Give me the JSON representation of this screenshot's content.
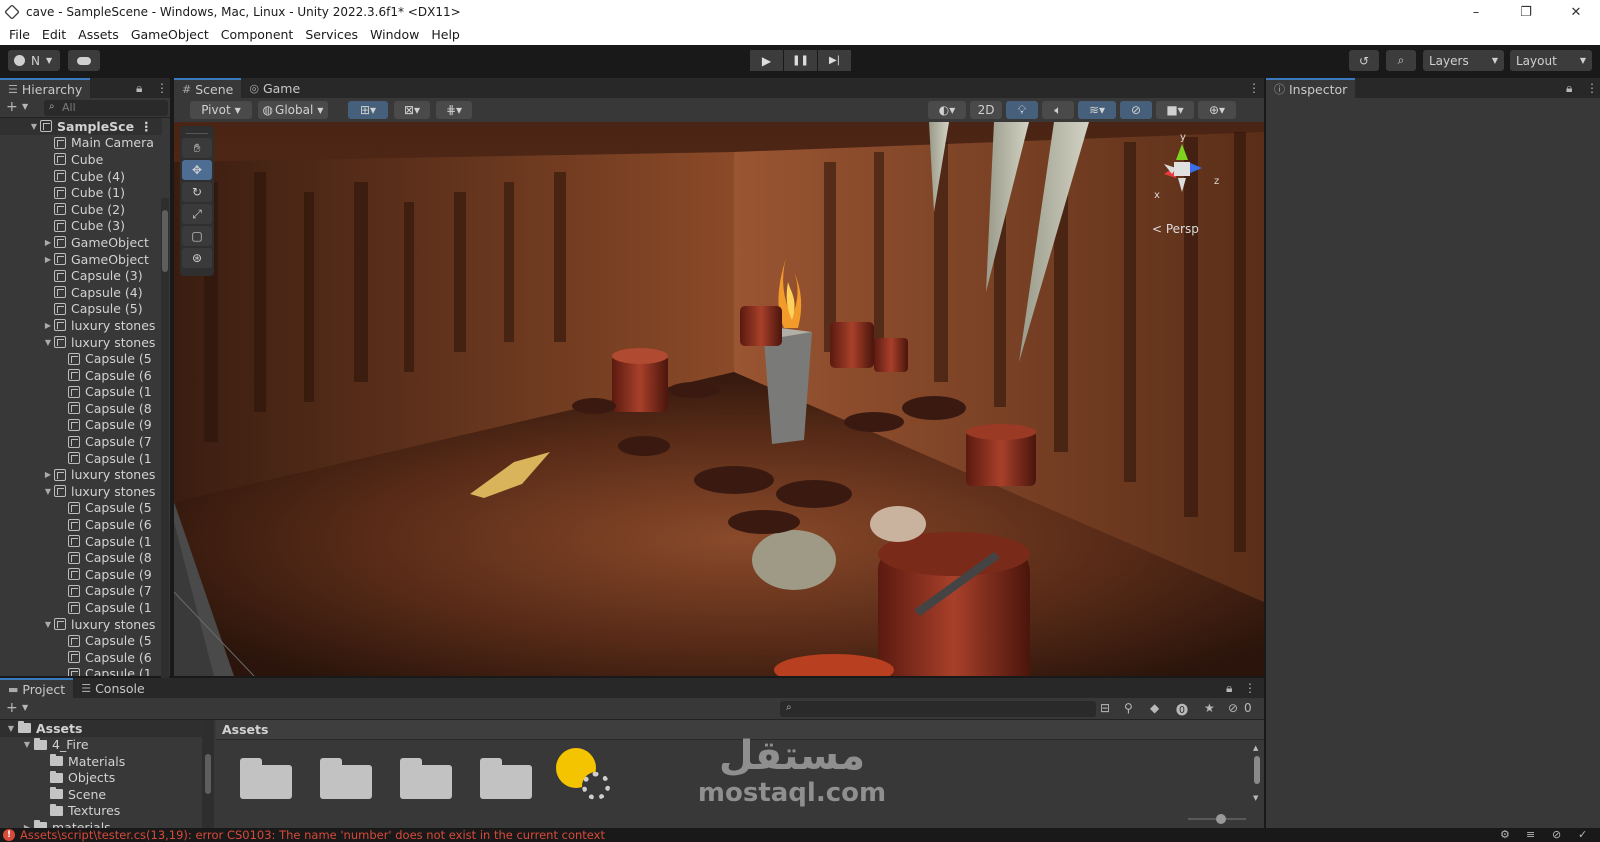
{
  "window": {
    "title": "cave - SampleScene - Windows, Mac, Linux - Unity 2022.3.6f1* <DX11>",
    "controls": [
      "–",
      "❐",
      "✕"
    ]
  },
  "menu": [
    "File",
    "Edit",
    "Assets",
    "GameObject",
    "Component",
    "Services",
    "Window",
    "Help"
  ],
  "toolbar": {
    "account_label": "N",
    "layers_label": "Layers",
    "layout_label": "Layout"
  },
  "hierarchy": {
    "tab_label": "Hierarchy",
    "search_placeholder": "All",
    "items": [
      {
        "label": "SampleSce",
        "depth": 0,
        "arrow": "▼",
        "root": true
      },
      {
        "label": "Main Camera",
        "depth": 1,
        "arrow": ""
      },
      {
        "label": "Cube",
        "depth": 1,
        "arrow": ""
      },
      {
        "label": "Cube (4)",
        "depth": 1,
        "arrow": ""
      },
      {
        "label": "Cube (1)",
        "depth": 1,
        "arrow": ""
      },
      {
        "label": "Cube (2)",
        "depth": 1,
        "arrow": ""
      },
      {
        "label": "Cube (3)",
        "depth": 1,
        "arrow": ""
      },
      {
        "label": "GameObject",
        "depth": 1,
        "arrow": "▶"
      },
      {
        "label": "GameObject",
        "depth": 1,
        "arrow": "▶"
      },
      {
        "label": "Capsule (3)",
        "depth": 1,
        "arrow": ""
      },
      {
        "label": "Capsule (4)",
        "depth": 1,
        "arrow": ""
      },
      {
        "label": "Capsule (5)",
        "depth": 1,
        "arrow": ""
      },
      {
        "label": "luxury stones",
        "depth": 1,
        "arrow": "▶"
      },
      {
        "label": "luxury stones",
        "depth": 1,
        "arrow": "▼"
      },
      {
        "label": "Capsule (5",
        "depth": 2,
        "arrow": ""
      },
      {
        "label": "Capsule (6",
        "depth": 2,
        "arrow": ""
      },
      {
        "label": "Capsule (1",
        "depth": 2,
        "arrow": ""
      },
      {
        "label": "Capsule (8",
        "depth": 2,
        "arrow": ""
      },
      {
        "label": "Capsule (9",
        "depth": 2,
        "arrow": ""
      },
      {
        "label": "Capsule (7",
        "depth": 2,
        "arrow": ""
      },
      {
        "label": "Capsule (1",
        "depth": 2,
        "arrow": ""
      },
      {
        "label": "luxury stones",
        "depth": 1,
        "arrow": "▶"
      },
      {
        "label": "luxury stones",
        "depth": 1,
        "arrow": "▼"
      },
      {
        "label": "Capsule (5",
        "depth": 2,
        "arrow": ""
      },
      {
        "label": "Capsule (6",
        "depth": 2,
        "arrow": ""
      },
      {
        "label": "Capsule (1",
        "depth": 2,
        "arrow": ""
      },
      {
        "label": "Capsule (8",
        "depth": 2,
        "arrow": ""
      },
      {
        "label": "Capsule (9",
        "depth": 2,
        "arrow": ""
      },
      {
        "label": "Capsule (7",
        "depth": 2,
        "arrow": ""
      },
      {
        "label": "Capsule (1",
        "depth": 2,
        "arrow": ""
      },
      {
        "label": "luxury stones",
        "depth": 1,
        "arrow": "▼"
      },
      {
        "label": "Capsule (5",
        "depth": 2,
        "arrow": ""
      },
      {
        "label": "Capsule (6",
        "depth": 2,
        "arrow": ""
      },
      {
        "label": "Capsule (1",
        "depth": 2,
        "arrow": ""
      }
    ]
  },
  "scene": {
    "tabs": [
      {
        "label": "Scene",
        "icon": "#",
        "active": true
      },
      {
        "label": "Game",
        "icon": "◎",
        "active": false
      }
    ],
    "pivot_label": "Pivot",
    "global_label": "Global",
    "mode_2d_label": "2D",
    "gizmo": {
      "y": "y",
      "x": "x",
      "z": "z",
      "persp": "< Persp"
    }
  },
  "inspector": {
    "tab_label": "Inspector"
  },
  "project": {
    "tabs": [
      {
        "label": "Project",
        "active": true
      },
      {
        "label": "Console",
        "active": false
      }
    ],
    "hidden_count": "0",
    "tree": [
      {
        "label": "Assets",
        "depth": 0,
        "arrow": "▼",
        "bold": true
      },
      {
        "label": "4_Fire",
        "depth": 1,
        "arrow": "▼"
      },
      {
        "label": "Materials",
        "depth": 2,
        "arrow": ""
      },
      {
        "label": "Objects",
        "depth": 2,
        "arrow": ""
      },
      {
        "label": "Scene",
        "depth": 2,
        "arrow": ""
      },
      {
        "label": "Textures",
        "depth": 2,
        "arrow": ""
      },
      {
        "label": "materials",
        "depth": 1,
        "arrow": "▶"
      }
    ],
    "breadcrumb": "Assets"
  },
  "watermark": {
    "arabic": "مستقل",
    "latin": "mostaql.com"
  },
  "status": {
    "error_text": "Assets\\script\\tester.cs(13,19): error CS0103: The name 'number' does not exist in the current context"
  },
  "colors": {
    "accent": "#3a79bb",
    "error": "#d84a3a",
    "panel": "#383838",
    "bar": "#191919"
  }
}
